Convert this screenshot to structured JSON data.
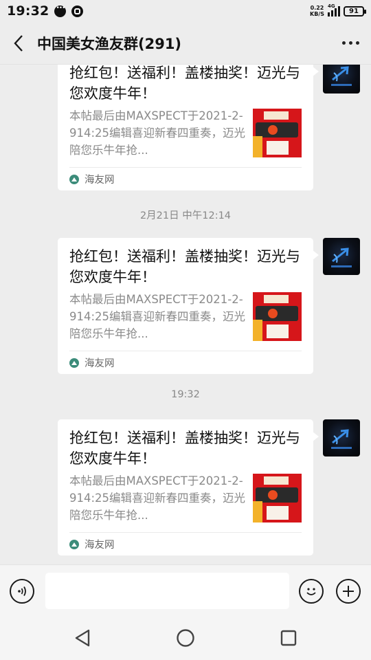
{
  "status_bar": {
    "time": "19:32",
    "speed_value": "0.22",
    "speed_unit": "KB/S",
    "network": "4G",
    "battery": "91"
  },
  "header": {
    "title": "中国美女渔友群(291)"
  },
  "messages": [
    {
      "title": "抢红包！送福利！盖楼抽奖！迈光与您欢度牛年！",
      "desc": "本帖最后由MAXSPECT于2021-2-914:25编辑喜迎新春四重奏，迈光陪您乐牛年抢...",
      "source": "海友网"
    },
    {
      "title": "抢红包！送福利！盖楼抽奖！迈光与您欢度牛年！",
      "desc": "本帖最后由MAXSPECT于2021-2-914:25编辑喜迎新春四重奏，迈光陪您乐牛年抢...",
      "source": "海友网"
    },
    {
      "title": "抢红包！送福利！盖楼抽奖！迈光与您欢度牛年！",
      "desc": "本帖最后由MAXSPECT于2021-2-914:25编辑喜迎新春四重奏，迈光陪您乐牛年抢...",
      "source": "海友网"
    }
  ],
  "timestamps": [
    "2月21日 中午12:14",
    "19:32"
  ],
  "input": {
    "value": ""
  },
  "icons": {
    "back": "back-arrow-icon",
    "more": "more-dots-icon",
    "voice": "voice-icon",
    "emoji": "emoji-icon",
    "add": "plus-icon",
    "nav_back": "triangle-back-icon",
    "nav_home": "circle-home-icon",
    "nav_recent": "square-recent-icon"
  },
  "colors": {
    "background": "#ededed",
    "card": "#ffffff",
    "thumbnail_red": "#d6161a",
    "text_gray": "#8a8a8a"
  }
}
